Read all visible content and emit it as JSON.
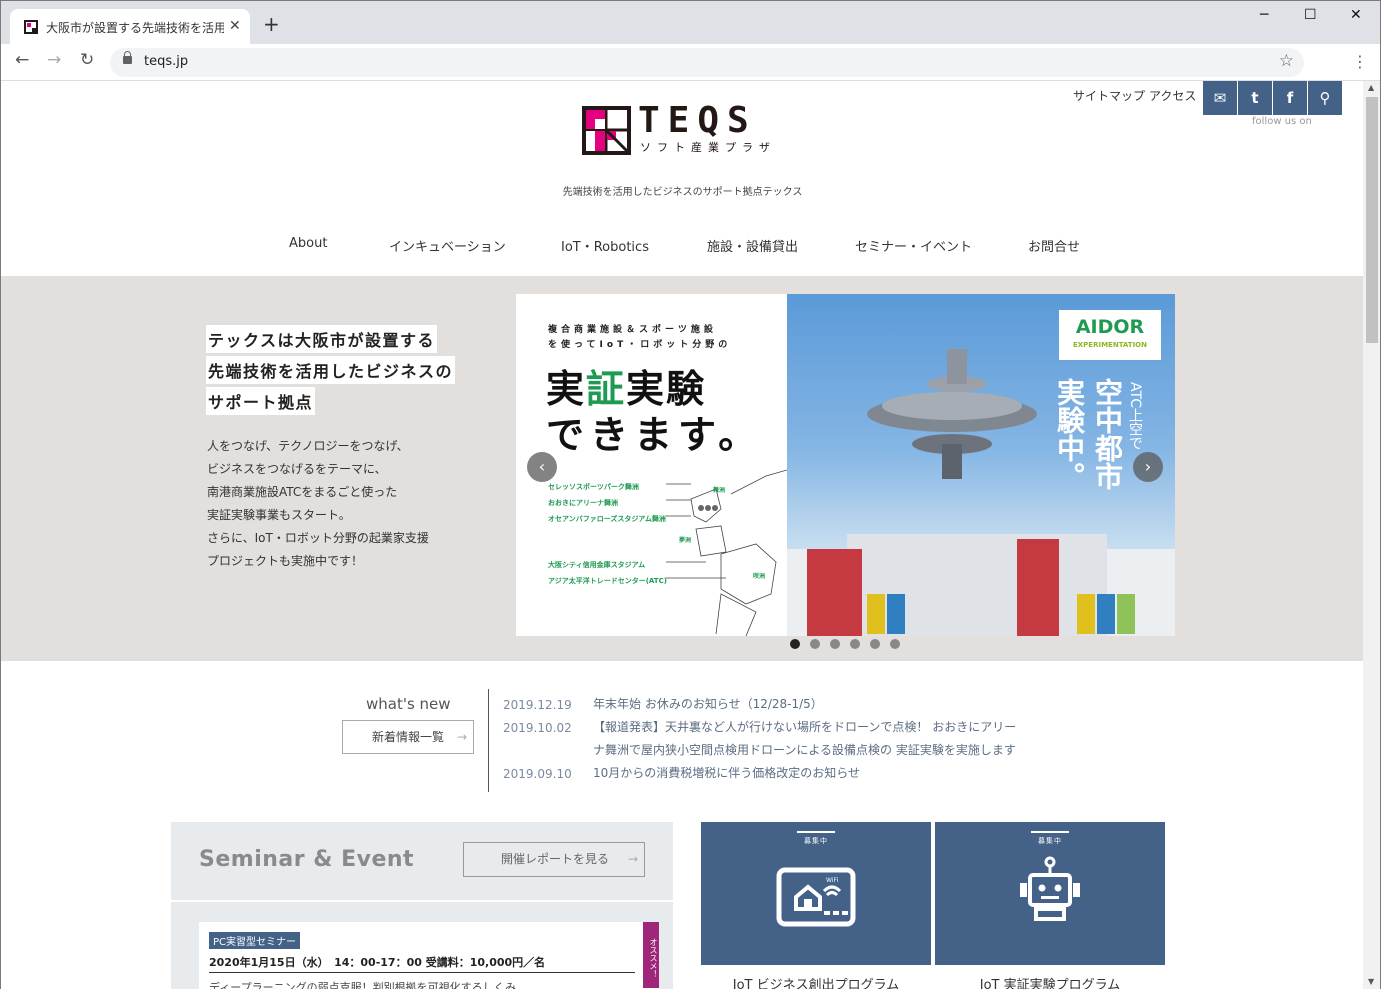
{
  "browser": {
    "tab_title": "大阪市が設置する先端技術を活用",
    "tab_close": "✕",
    "new_tab": "+",
    "url": "teqs.jp",
    "window_controls": [
      "─",
      "☐",
      "✕"
    ]
  },
  "header": {
    "links": [
      "サイトマップ",
      "アクセス"
    ],
    "social_icons": [
      "mail-icon",
      "twitter-icon",
      "facebook-icon",
      "search-icon"
    ],
    "follow_text": "follow us on",
    "logo_main": "TEQS",
    "logo_sub": "ソフト産業プラザ",
    "tagline": "先端技術を活用したビジネスのサポート拠点テックス"
  },
  "nav": {
    "items": [
      "About",
      "インキュベーション",
      "IoT・Robotics",
      "施設・設備貸出",
      "セミナー・イベント",
      "お問合せ"
    ]
  },
  "hero": {
    "headline": [
      "テックスは大阪市が設置する",
      "先端技術を活用したビジネスの",
      "サポート拠点"
    ],
    "body": [
      "人をつなげ、テクノロジーをつなげ、",
      "ビジネスをつなげるをテーマに、",
      "南港商業施設ATCをまるごと使った",
      "実証実験事業もスタート。",
      "さらに、IoT・ロボット分野の起業家支援",
      "プロジェクトも実施中です！"
    ]
  },
  "slider": {
    "intro_line1": "複合商業施設＆スポーツ施設",
    "intro_line2": "を使ってIoT・ロボット分野の",
    "big1a": "実",
    "big1b": "証",
    "big1c": "実験",
    "big2": "できます。",
    "venues": [
      "セレッソスポーツパーク舞洲",
      "おおきにアリーナ舞洲",
      "オセアンバファローズスタジアム舞洲",
      "大阪シティ信用金庫スタジアム",
      "アジア太平洋トレードセンター(ATC)"
    ],
    "map_labels": [
      "舞洲",
      "夢洲",
      "咲洲"
    ],
    "badge_title": "AIDOR",
    "badge_sub": "EXPERIMENTATION",
    "vertical_1": "ATC上空で",
    "vertical_2": "空中都市",
    "vertical_3": "実験中。",
    "prev": "‹",
    "next": "›",
    "dot_count": 6,
    "active_dot": 0
  },
  "news": {
    "heading": "what's new",
    "button": "新着情報一覧",
    "arrow": "→",
    "items": [
      {
        "date": "2019.12.19",
        "text": "年末年始 お休みのお知らせ（12/28-1/5）"
      },
      {
        "date": "2019.10.02",
        "text": "【報道発表】天井裏など人が行けない場所をドローンで点検！ おおきにアリーナ舞洲で屋内狭小空間点検用ドローンによる設備点検の 実証実験を実施します"
      },
      {
        "date": "2019.09.10",
        "text": "10月からの消費税増税に伴う価格改定のお知らせ"
      }
    ]
  },
  "seminar": {
    "title": "Seminar & Event",
    "button": "開催レポートを見る",
    "card_tag": "PC実習型セミナー",
    "card_date": "2020年1月15日（水）　14：00-17：00 受講料：10,000円／名",
    "card_desc": "ディープラーニングの弱点克服！判別根拠を可視化するしくみ",
    "recommend": "オススメ！"
  },
  "programs": [
    {
      "label": "募集中",
      "title": "IoT ビジネス創出プログラム",
      "icon": "tablet-wifi-icon"
    },
    {
      "label": "募集中",
      "title": "IoT 実証実験プログラム",
      "icon": "robot-icon"
    }
  ],
  "colors": {
    "accent": "#446188",
    "magenta": "#e4007f",
    "hero_bg": "#e2dfdc",
    "green": "#1f9a52"
  }
}
